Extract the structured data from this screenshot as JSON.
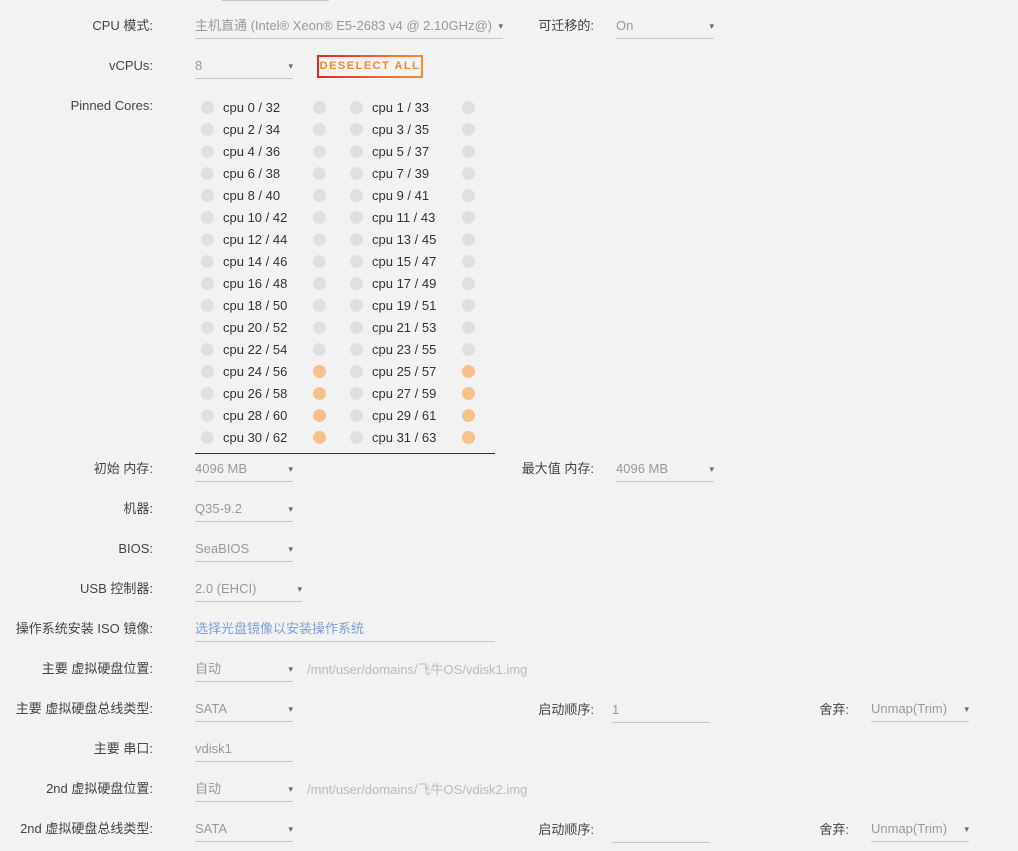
{
  "cpu_mode": {
    "label": "CPU 模式:",
    "value": "主机直通 (Intel® Xeon® E5-2683 v4 @ 2.10GHz@)"
  },
  "migratable": {
    "label": "可迁移的:",
    "value": "On"
  },
  "vcpus": {
    "label": "vCPUs:",
    "value": "8",
    "deselect_label": "DESELECT ALL"
  },
  "pinned": {
    "label": "Pinned Cores:",
    "cores": [
      "cpu 0 / 32",
      "cpu 1 / 33",
      "cpu 2 / 34",
      "cpu 3 / 35",
      "cpu 4 / 36",
      "cpu 5 / 37",
      "cpu 6 / 38",
      "cpu 7 / 39",
      "cpu 8 / 40",
      "cpu 9 / 41",
      "cpu 10 / 42",
      "cpu 11 / 43",
      "cpu 12 / 44",
      "cpu 13 / 45",
      "cpu 14 / 46",
      "cpu 15 / 47",
      "cpu 16 / 48",
      "cpu 17 / 49",
      "cpu 18 / 50",
      "cpu 19 / 51",
      "cpu 20 / 52",
      "cpu 21 / 53",
      "cpu 22 / 54",
      "cpu 23 / 55",
      "cpu 24 / 56",
      "cpu 25 / 57",
      "cpu 26 / 58",
      "cpu 27 / 59",
      "cpu 28 / 60",
      "cpu 29 / 61",
      "cpu 30 / 62",
      "cpu 31 / 63"
    ],
    "selected_threads": [
      "56",
      "57",
      "58",
      "59",
      "60",
      "61",
      "62",
      "63"
    ],
    "selected_color": "#f8c08b"
  },
  "init_mem": {
    "label": "初始 内存:",
    "value": "4096 MB"
  },
  "max_mem": {
    "label": "最大值 内存:",
    "value": "4096 MB"
  },
  "machine": {
    "label": "机器:",
    "value": "Q35-9.2"
  },
  "bios": {
    "label": "BIOS:",
    "value": "SeaBIOS"
  },
  "usb": {
    "label": "USB 控制器:",
    "value": "2.0 (EHCI)"
  },
  "iso": {
    "label": "操作系统安装 ISO 镜像:",
    "placeholder": "选择光盘镜像以安装操作系统"
  },
  "disk1": {
    "loc_label": "主要 虚拟硬盘位置:",
    "loc_value": "自动",
    "path": "/mnt/user/domains/飞牛OS/vdisk1.img",
    "bus_label": "主要 虚拟硬盘总线类型:",
    "bus_value": "SATA",
    "boot_label": "启动顺序:",
    "boot_value": "1",
    "discard_label": "舍弃:",
    "discard_value": "Unmap(Trim)",
    "serial_label": "主要 串口:",
    "serial_value": "vdisk1"
  },
  "disk2": {
    "loc_label": "2nd 虚拟硬盘位置:",
    "loc_value": "自动",
    "path": "/mnt/user/domains/飞牛OS/vdisk2.img",
    "bus_label": "2nd 虚拟硬盘总线类型:",
    "bus_value": "SATA",
    "boot_label": "启动顺序:",
    "boot_value": "",
    "discard_label": "舍弃:",
    "discard_value": "Unmap(Trim)"
  },
  "arrow": "▾"
}
